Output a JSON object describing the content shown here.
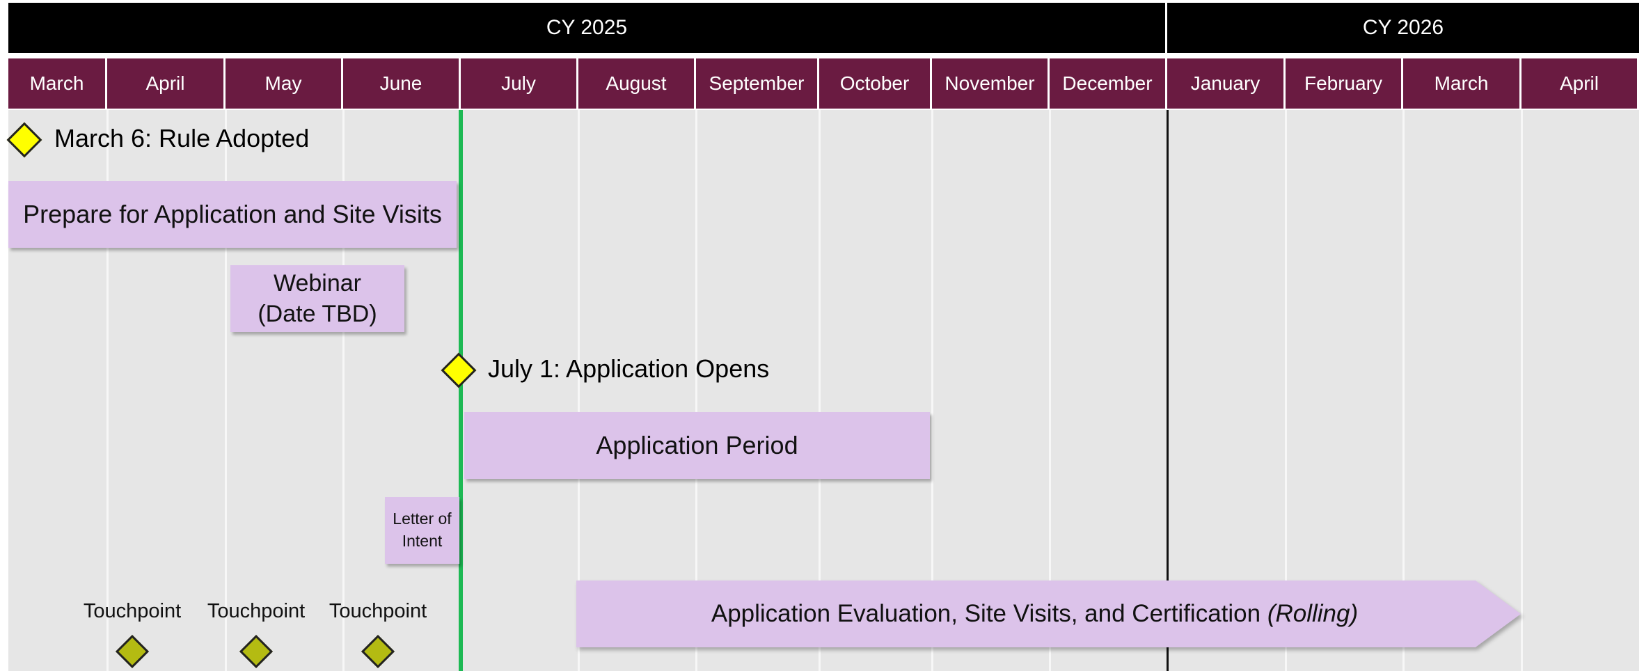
{
  "years": [
    {
      "label": "CY 2025",
      "startIndex": 0,
      "endIndex": 9
    },
    {
      "label": "CY 2026",
      "startIndex": 10,
      "endIndex": 13
    }
  ],
  "months": [
    "March",
    "April",
    "May",
    "June",
    "July",
    "August",
    "September",
    "October",
    "November",
    "December",
    "January",
    "February",
    "March",
    "April"
  ],
  "milestones": [
    {
      "label": "March 6: Rule Adopted",
      "monthIndex": 0
    },
    {
      "label": "July 1: Application Opens",
      "monthIndex": 4
    }
  ],
  "tasks": [
    {
      "label": "Prepare for Application and Site Visits",
      "startIndex": 0,
      "endIndex": 3
    },
    {
      "label": "Webinar\n(Date TBD)",
      "startIndex": 2,
      "endIndex": 2
    },
    {
      "label": "Application Period",
      "startIndex": 4,
      "endIndex": 8
    },
    {
      "label": "Letter of Intent",
      "startIndex": 3,
      "endIndex": 3
    },
    {
      "label": "Application Evaluation, Site Visits, and Certification",
      "label_em": "(Rolling)",
      "startIndex": 5,
      "endIndex": 12
    }
  ],
  "touchpoints": [
    {
      "label": "Touchpoint",
      "monthIndex": 1
    },
    {
      "label": "Touchpoint",
      "monthIndex": 2
    },
    {
      "label": "Touchpoint",
      "monthIndex": 3
    }
  ],
  "colors": {
    "year_header": "#000000",
    "month_header": "#6a1b41",
    "task_fill": "#dcc3ea",
    "milestone_fill": "#ffff00",
    "touchpoint_fill": "#b4bb12",
    "today_line": "#1db954",
    "band": "#e6e6e6"
  }
}
